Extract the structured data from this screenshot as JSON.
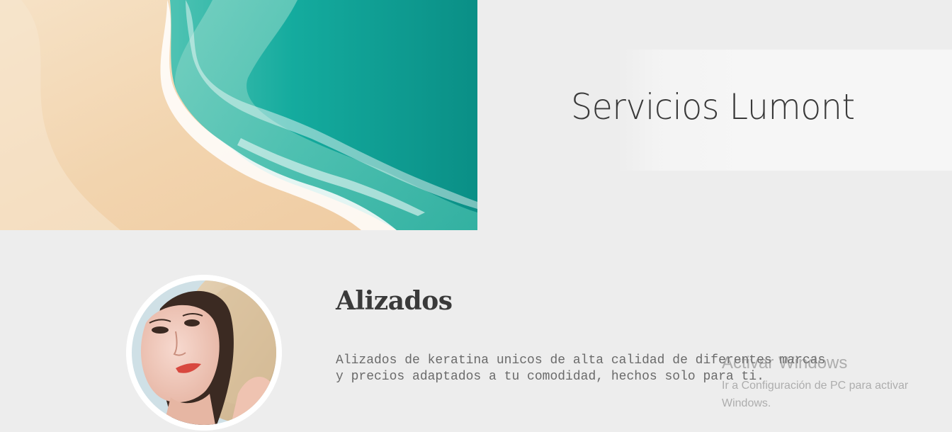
{
  "header": {
    "title": "Servicios Lumont"
  },
  "service": {
    "title": "Alizados",
    "description": "Alizados de keratina unicos de alta calidad de diferentes marcas y precios adaptados a tu comodidad, hechos solo para ti."
  },
  "watermark": {
    "title": "Activar Windows",
    "body": "Ir a Configuración de PC para activar Windows."
  },
  "colors": {
    "background": "#ededed",
    "banner": "#f6f6f6",
    "sea": "#13a99c",
    "sand": "#f1d3ad",
    "text_dark": "#3a3a3a",
    "text_muted": "#6a6a6a"
  }
}
